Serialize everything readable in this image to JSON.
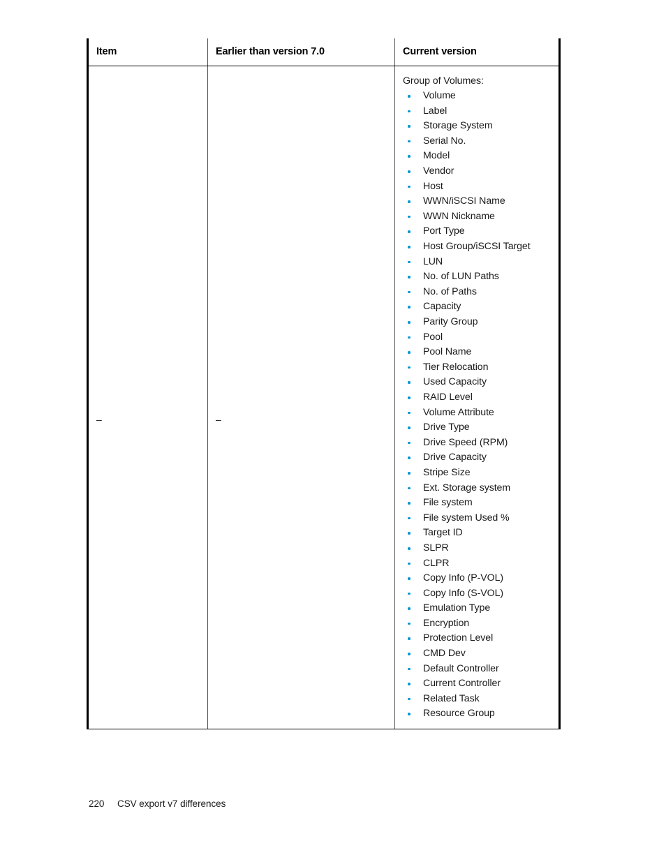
{
  "page": {
    "background_color": "#ffffff",
    "bullet_color": "#0096d6",
    "border_color": "#000000"
  },
  "table": {
    "headers": [
      "Item",
      "Earlier than version 7.0",
      "Current version"
    ],
    "row": {
      "item": "–",
      "earlier_than_v7": "–",
      "current_version": {
        "intro": "Group of Volumes:",
        "items": [
          "Volume",
          "Label",
          "Storage System",
          "Serial No.",
          "Model",
          "Vendor",
          "Host",
          "WWN/iSCSI Name",
          "WWN Nickname",
          "Port Type",
          "Host Group/iSCSI Target",
          "LUN",
          "No. of LUN Paths",
          "No. of Paths",
          "Capacity",
          "Parity Group",
          "Pool",
          "Pool Name",
          "Tier Relocation",
          "Used Capacity",
          "RAID Level",
          "Volume Attribute",
          "Drive Type",
          "Drive Speed (RPM)",
          "Drive Capacity",
          "Stripe Size",
          "Ext. Storage system",
          "File system",
          "File system Used %",
          "Target ID",
          "SLPR",
          "CLPR",
          "Copy Info (P-VOL)",
          "Copy Info (S-VOL)",
          "Emulation Type",
          "Encryption",
          "Protection Level",
          "CMD Dev",
          "Default Controller",
          "Current Controller",
          "Related Task",
          "Resource Group"
        ]
      }
    }
  },
  "footer": {
    "page_number": "220",
    "section_title": "CSV export v7 differences"
  }
}
